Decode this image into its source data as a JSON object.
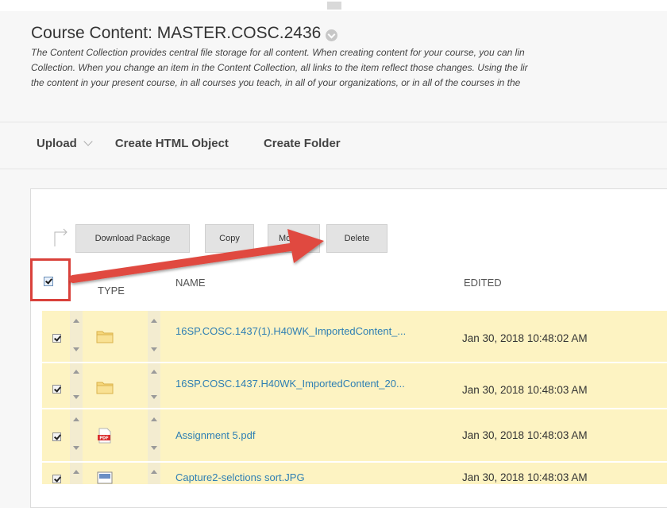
{
  "page": {
    "title": "Course Content: MASTER.COSC.2436",
    "description_lines": [
      "The Content Collection provides central file storage for all content. When creating content for your course, you can lin",
      "Collection. When you change an item in the Content Collection, all links to the item reflect those changes. Using the lir",
      "the content in your present course, in all courses you teach, in all of your organizations, or in all of the courses in the"
    ]
  },
  "action_bar": {
    "upload_label": "Upload",
    "create_html_label": "Create HTML Object",
    "create_folder_label": "Create Folder"
  },
  "toolbar": {
    "download_label": "Download Package",
    "copy_label": "Copy",
    "move_label": "Mo",
    "delete_label": "Delete"
  },
  "table": {
    "headers": {
      "type": "TYPE",
      "name": "NAME",
      "edited": "EDITED"
    },
    "rows": [
      {
        "type_icon": "folder-icon",
        "name": "16SP.COSC.1437(1).H40WK_ImportedContent_...",
        "edited": "Jan 30, 2018 10:48:02 AM",
        "checked": true
      },
      {
        "type_icon": "folder-icon",
        "name": "16SP.COSC.1437.H40WK_ImportedContent_20...",
        "edited": "Jan 30, 2018 10:48:03 AM",
        "checked": true
      },
      {
        "type_icon": "pdf-icon",
        "name": "Assignment 5.pdf",
        "edited": "Jan 30, 2018 10:48:03 AM",
        "checked": true
      },
      {
        "type_icon": "image-icon",
        "name": "Capture2-selctions sort.JPG",
        "edited": "Jan 30, 2018 10:48:03 AM",
        "checked": true
      }
    ]
  },
  "colors": {
    "row_highlight": "#fdf3c2",
    "link": "#2f7fb3",
    "annotation_red": "#d9413b"
  }
}
